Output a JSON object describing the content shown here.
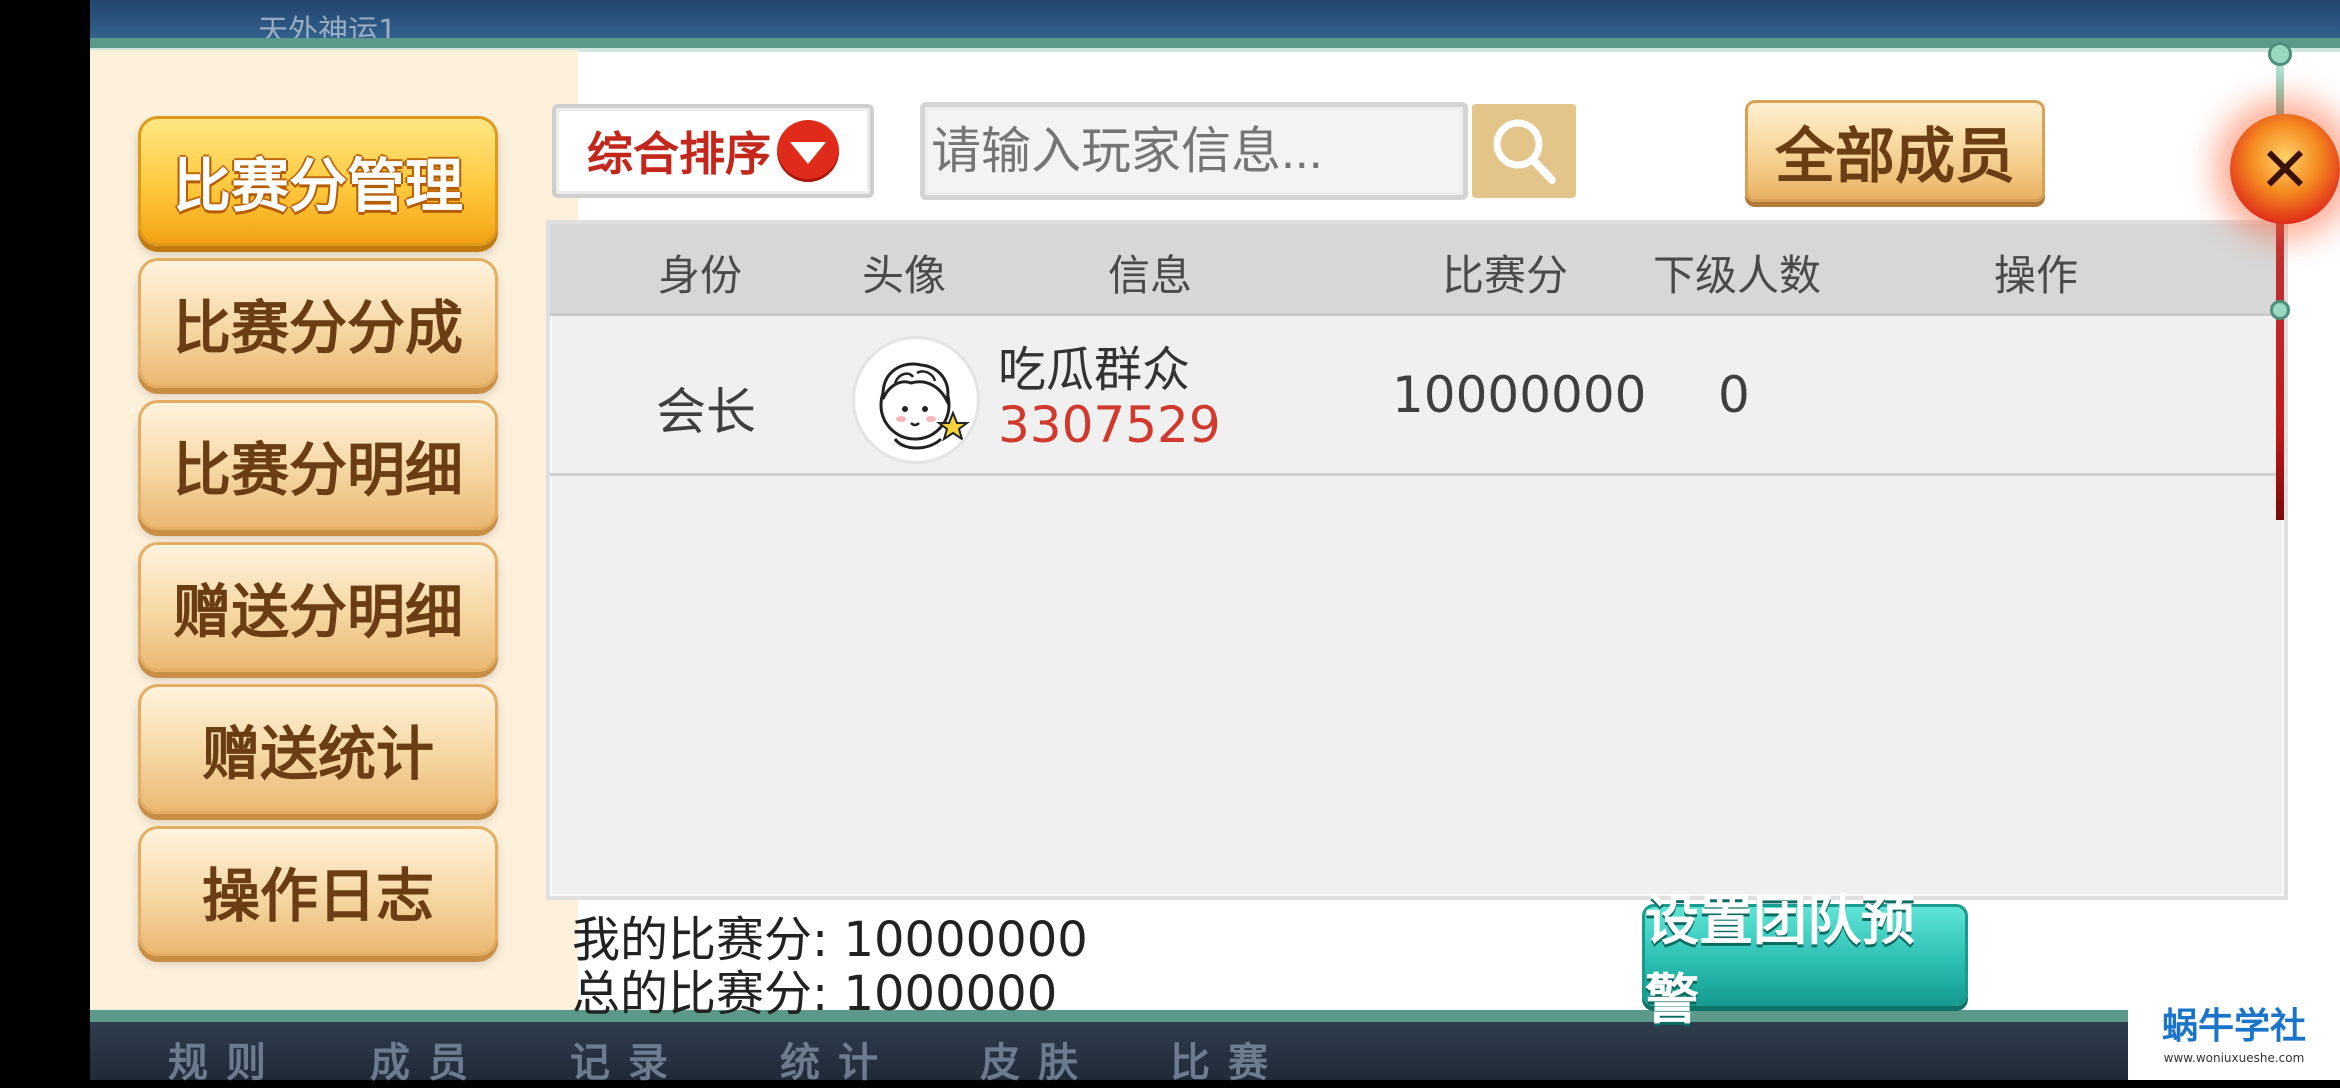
{
  "background": {
    "top_label": "天外神运1",
    "bottom_tabs": [
      "规则",
      "成员",
      "记录",
      "统计",
      "皮肤",
      "比赛"
    ]
  },
  "sidebar": {
    "items": [
      {
        "label": "比赛分管理",
        "active": true
      },
      {
        "label": "比赛分分成",
        "active": false
      },
      {
        "label": "比赛分明细",
        "active": false
      },
      {
        "label": "赠送分明细",
        "active": false
      },
      {
        "label": "赠送统计",
        "active": false
      },
      {
        "label": "操作日志",
        "active": false
      }
    ]
  },
  "toolbar": {
    "sort_label": "综合排序",
    "sort_icon": "dropdown-arrow-icon",
    "search_placeholder": "请输入玩家信息...",
    "search_icon": "search-icon",
    "all_members_label": "全部成员"
  },
  "table": {
    "columns": [
      "身份",
      "头像",
      "信息",
      "比赛分",
      "下级人数",
      "操作"
    ],
    "rows": [
      {
        "role": "会长",
        "avatar": "cartoon-avatar",
        "name": "吃瓜群众",
        "id": "3307529",
        "score": "10000000",
        "subordinates": "0",
        "action": ""
      }
    ]
  },
  "footer": {
    "my_score_label": "我的比赛分:",
    "my_score_value": "10000000",
    "total_score_label": "总的比赛分:",
    "total_score_value": "1000000",
    "team_alert_label": "设置团队预警"
  },
  "close": {
    "icon": "close-icon",
    "symbol": "✕"
  },
  "watermark": {
    "main": "蜗牛学社",
    "sub": "www.woniuxueshe.com"
  },
  "colors": {
    "accent_orange": "#ffc93e",
    "id_red": "#d0392b",
    "teal": "#2cc0b3",
    "frame_teal": "#5b9a8a"
  }
}
